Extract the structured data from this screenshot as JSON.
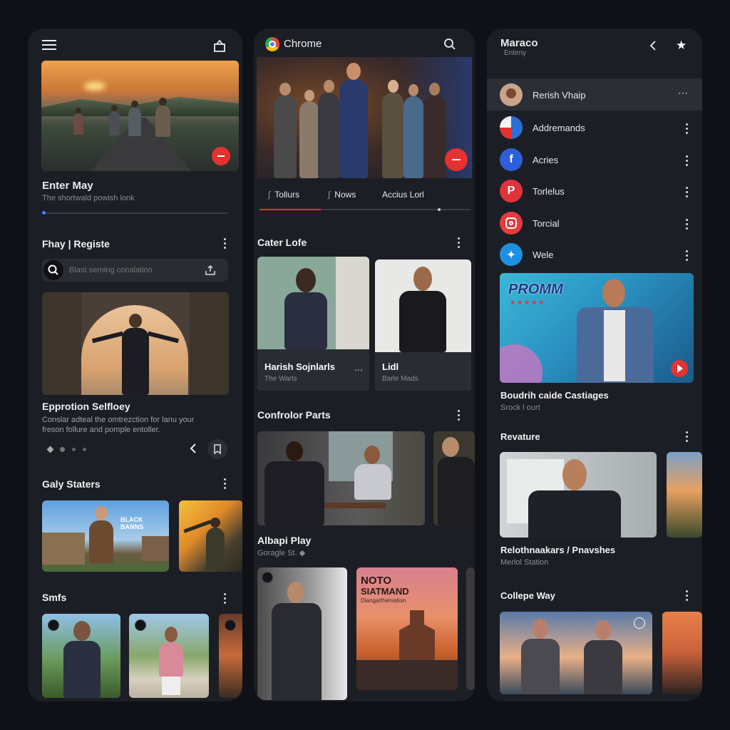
{
  "panel1": {
    "hero": {
      "title": "Enter May",
      "subtitle": "The shortwald powish lonk",
      "progress": 0.02
    },
    "section1": {
      "title": "Fhay | Registe"
    },
    "search": {
      "placeholder": "Blast serning conalation"
    },
    "feature": {
      "title": "Epprotion Selfloey",
      "desc1": "Conslar adteal the omtrezction for lanu your",
      "desc2": "freson follure and pomple entoller."
    },
    "section2": {
      "title": "Galy Staters",
      "card_text": "BLACK BANNS"
    },
    "section3": {
      "title": "Smfs"
    }
  },
  "panel2": {
    "app_title": "Chrome",
    "tabs": [
      "Tollurs",
      "Nows",
      "Accius Lorl"
    ],
    "section1": {
      "title": "Cater Lofe"
    },
    "card1": {
      "title": "Harish Sojnlarls",
      "sub": "The Warts"
    },
    "card2": {
      "title": "Lidl",
      "sub": "Barle Mads"
    },
    "section2": {
      "title": "Confrolor Parts"
    },
    "section3": {
      "title": "Albapi Play",
      "sub": "Goragle St. ◆"
    },
    "poster": {
      "title1": "NOTO",
      "title2": "SIATMAND",
      "sub": "Diangarthervation"
    }
  },
  "panel3": {
    "header_title": "Maraco",
    "header_sub": "Enteny",
    "list": [
      {
        "label": "Rerish Vhaip",
        "icon": "avatar-icon",
        "color": "#c9a38a"
      },
      {
        "label": "Addremands",
        "icon": "chrome-icon",
        "color": "#2a6fd6"
      },
      {
        "label": "Acries",
        "icon": "facebook-icon",
        "color": "#2d5fd8"
      },
      {
        "label": "Torlelus",
        "icon": "pinterest-icon",
        "color": "#e0343c"
      },
      {
        "label": "Torcial",
        "icon": "instagram-icon",
        "color": "#e43c3c"
      },
      {
        "label": "Wele",
        "icon": "twitter-icon",
        "color": "#1e90e0"
      }
    ],
    "promo": {
      "brand": "PROMM",
      "title": "Boudrih caide Castiages",
      "sub": "Srock l ourt"
    },
    "section2": {
      "title": "Revature",
      "card_title": "Relothnaakars / Pnavshes",
      "card_sub": "Merlol Station"
    },
    "section3": {
      "title": "Collepe Way"
    }
  },
  "colors": {
    "accent_red": "#e5312f",
    "progress_blue": "#3b82f6",
    "panel_bg": "#1c1e25"
  }
}
